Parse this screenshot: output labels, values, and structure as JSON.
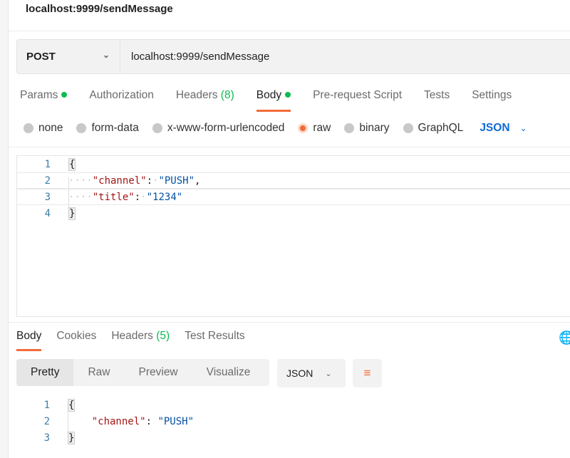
{
  "request": {
    "title": "localhost:9999/sendMessage",
    "method": "POST",
    "url": "localhost:9999/sendMessage"
  },
  "tabs": [
    {
      "label": "Params"
    },
    {
      "label": "Authorization"
    },
    {
      "label": "Headers",
      "count": "(8)"
    },
    {
      "label": "Body"
    },
    {
      "label": "Pre-request Script"
    },
    {
      "label": "Tests"
    },
    {
      "label": "Settings"
    }
  ],
  "body_types": [
    "none",
    "form-data",
    "x-www-form-urlencoded",
    "raw",
    "binary",
    "GraphQL"
  ],
  "body_type_selected": "raw",
  "body_format": "JSON",
  "request_body": {
    "line_numbers": [
      "1",
      "2",
      "3",
      "4"
    ],
    "open": "{",
    "close": "}",
    "k1": "\"channel\"",
    "v1": "\"PUSH\"",
    "k2": "\"title\"",
    "v2": "\"1234\""
  },
  "response": {
    "tabs": [
      {
        "label": "Body"
      },
      {
        "label": "Cookies"
      },
      {
        "label": "Headers",
        "count": "(5)"
      },
      {
        "label": "Test Results"
      }
    ],
    "views": [
      "Pretty",
      "Raw",
      "Preview",
      "Visualize"
    ],
    "format": "JSON",
    "line_numbers": [
      "1",
      "2",
      "3"
    ],
    "open": "{",
    "close": "}",
    "k1": "\"channel\"",
    "v1": "\"PUSH\""
  },
  "colors": {
    "accent": "#f26b3a",
    "green": "#0cbb52",
    "link": "#0f6ad4"
  }
}
